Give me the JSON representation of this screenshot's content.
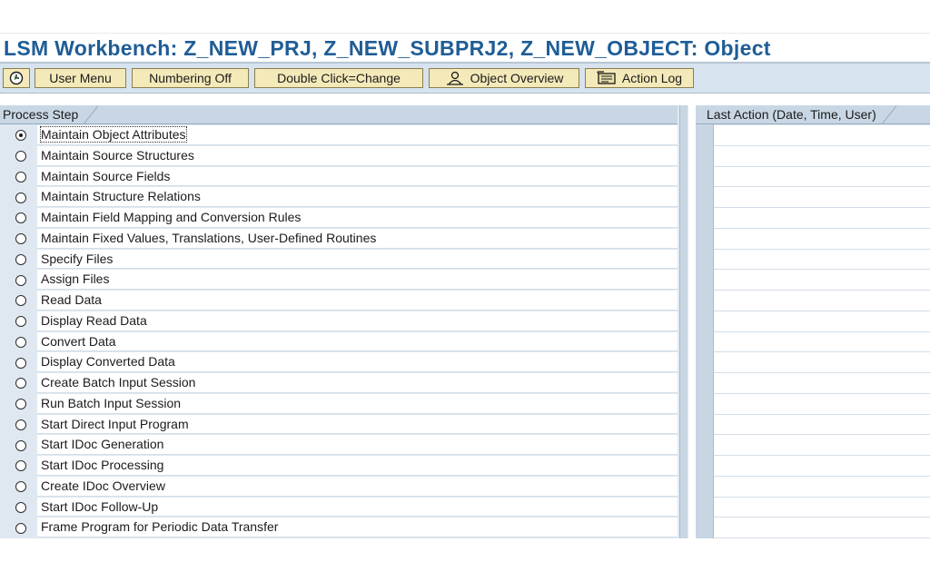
{
  "window": {
    "title": "LSM Workbench: Z_NEW_PRJ, Z_NEW_SUBPRJ2, Z_NEW_OBJECT: Object"
  },
  "toolbar": {
    "execute_icon": "execute-clock-icon",
    "user_menu": "User Menu",
    "numbering_off": "Numbering Off",
    "double_click": "Double Click=Change",
    "object_overview": "Object Overview",
    "object_overview_icon": "person-overview-icon",
    "action_log": "Action Log",
    "action_log_icon": "log-icon"
  },
  "process_table": {
    "header": "Process Step",
    "selected_index": 0,
    "steps": [
      {
        "label": "Maintain Object Attributes"
      },
      {
        "label": "Maintain Source Structures"
      },
      {
        "label": "Maintain Source Fields"
      },
      {
        "label": "Maintain Structure Relations"
      },
      {
        "label": "Maintain Field Mapping and Conversion Rules"
      },
      {
        "label": "Maintain Fixed Values, Translations, User-Defined Routines"
      },
      {
        "label": "Specify Files"
      },
      {
        "label": "Assign Files"
      },
      {
        "label": "Read Data"
      },
      {
        "label": "Display Read Data"
      },
      {
        "label": "Convert Data"
      },
      {
        "label": "Display Converted Data"
      },
      {
        "label": "Create Batch Input Session"
      },
      {
        "label": "Run Batch Input Session"
      },
      {
        "label": "Start Direct Input Program"
      },
      {
        "label": "Start IDoc Generation"
      },
      {
        "label": "Start IDoc Processing"
      },
      {
        "label": "Create IDoc Overview"
      },
      {
        "label": "Start IDoc Follow-Up"
      },
      {
        "label": "Frame Program for Periodic Data Transfer"
      }
    ]
  },
  "action_table": {
    "header": "Last Action (Date, Time, User)"
  },
  "colors": {
    "title": "#1f5d96",
    "toolbar_bg": "#d7e3ef",
    "button_bg": "#f4e9b9",
    "header_bg": "#c9d7e5"
  }
}
